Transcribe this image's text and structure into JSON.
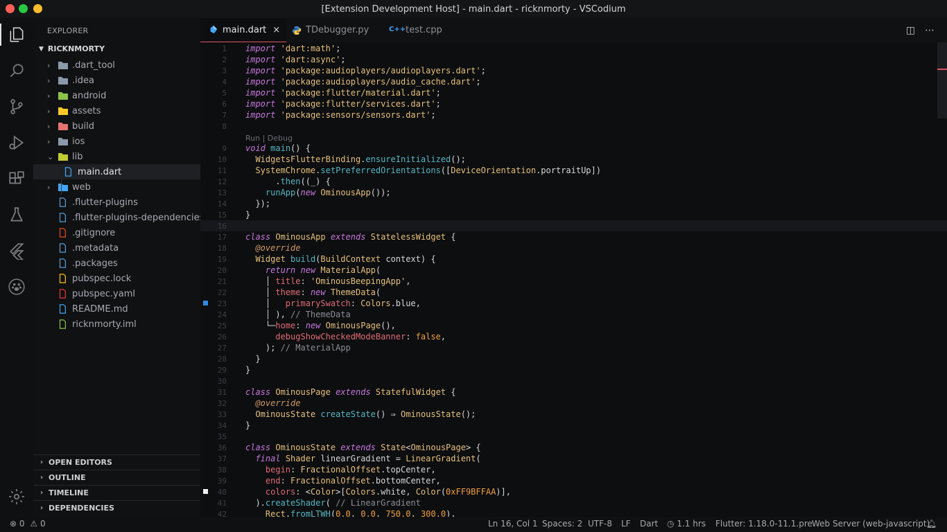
{
  "window": {
    "title": "[Extension Development Host] - main.dart - ricknmorty - VSCodium"
  },
  "explorer": {
    "header": "EXPLORER",
    "root": "RICKNMORTY",
    "items": [
      {
        "label": ".dart_tool",
        "kind": "folder",
        "icon": "folder-icon",
        "color": "#8a9aaa"
      },
      {
        "label": ".idea",
        "kind": "folder",
        "icon": "folder-icon",
        "color": "#8a9aaa"
      },
      {
        "label": "android",
        "kind": "folder",
        "icon": "android-folder-icon",
        "color": "#8bc34a"
      },
      {
        "label": "assets",
        "kind": "folder",
        "icon": "assets-folder-icon",
        "color": "#ffca28"
      },
      {
        "label": "build",
        "kind": "folder",
        "icon": "build-folder-icon",
        "color": "#e57373"
      },
      {
        "label": "ios",
        "kind": "folder",
        "icon": "ios-folder-icon",
        "color": "#8a9aaa"
      },
      {
        "label": "lib",
        "kind": "folder-open",
        "icon": "lib-folder-icon",
        "color": "#c0ca33"
      },
      {
        "label": "main.dart",
        "kind": "file",
        "icon": "dart-icon",
        "color": "#42a5f5"
      },
      {
        "label": "web",
        "kind": "folder",
        "icon": "web-folder-icon",
        "color": "#42a5f5"
      },
      {
        "label": ".flutter-plugins",
        "kind": "file",
        "icon": "file-icon",
        "color": "#5b9bd5"
      },
      {
        "label": ".flutter-plugins-dependencies",
        "kind": "file",
        "icon": "file-icon",
        "color": "#5b9bd5"
      },
      {
        "label": ".gitignore",
        "kind": "file",
        "icon": "git-icon",
        "color": "#e64a19"
      },
      {
        "label": ".metadata",
        "kind": "file",
        "icon": "file-icon",
        "color": "#5b9bd5"
      },
      {
        "label": ".packages",
        "kind": "file",
        "icon": "file-icon",
        "color": "#5b9bd5"
      },
      {
        "label": "pubspec.lock",
        "kind": "file",
        "icon": "lock-icon",
        "color": "#ffc107"
      },
      {
        "label": "pubspec.yaml",
        "kind": "file",
        "icon": "yaml-icon",
        "color": "#e53935"
      },
      {
        "label": "README.md",
        "kind": "file",
        "icon": "info-icon",
        "color": "#42a5f5"
      },
      {
        "label": "ricknmorty.iml",
        "kind": "file",
        "icon": "iml-icon",
        "color": "#8bc34a"
      }
    ],
    "sections": [
      "OPEN EDITORS",
      "OUTLINE",
      "TIMELINE",
      "DEPENDENCIES"
    ]
  },
  "tabs": [
    {
      "label": "main.dart",
      "icon": "dart-icon",
      "active": true,
      "close": "×"
    },
    {
      "label": "TDebugger.py",
      "icon": "python-icon",
      "active": false
    },
    {
      "label": "test.cpp",
      "icon": "cpp-icon",
      "active": false
    }
  ],
  "editor": {
    "codelens": "Run | Debug",
    "line_numbers": [
      "1",
      "2",
      "3",
      "4",
      "5",
      "6",
      "7",
      "8",
      "9",
      "10",
      "11",
      "12",
      "13",
      "14",
      "15",
      "16",
      "17",
      "18",
      "19",
      "20",
      "21",
      "22",
      "23",
      "24",
      "25",
      "26",
      "27",
      "28",
      "29",
      "30",
      "31",
      "32",
      "33",
      "34",
      "35",
      "36",
      "37",
      "38",
      "39",
      "40",
      "41",
      "42"
    ],
    "code": [
      "import 'dart:math';",
      "import 'dart:async';",
      "import 'package:audioplayers/audioplayers.dart';",
      "import 'package:audioplayers/audio_cache.dart';",
      "import 'package:flutter/material.dart';",
      "import 'package:flutter/services.dart';",
      "import 'package:sensors/sensors.dart';",
      "",
      "void main() {",
      "  WidgetsFlutterBinding.ensureInitialized();",
      "  SystemChrome.setPreferredOrientations([DeviceOrientation.portraitUp])",
      "      .then((_) {",
      "    runApp(new OminousApp());",
      "  });",
      "}",
      "",
      "class OminousApp extends StatelessWidget {",
      "  @override",
      "  Widget build(BuildContext context) {",
      "    return new MaterialApp(",
      "    │ title: 'OminousBeepingApp',",
      "    │ theme: new ThemeData(",
      "    │   primarySwatch: Colors.blue,",
      "    │ ), // ThemeData",
      "    └─home: new OminousPage(),",
      "      debugShowCheckedModeBanner: false,",
      "    ); // MaterialApp",
      "  }",
      "}",
      "",
      "class OminousPage extends StatefulWidget {",
      "  @override",
      "  OminousState createState() ⇒ OminousState();",
      "}",
      "",
      "class OminousState extends State<OminousPage> {",
      "  final Shader linearGradient = LinearGradient(",
      "    begin: FractionalOffset.topCenter,",
      "    end: FractionalOffset.bottomCenter,",
      "    colors: <Color>[Colors.white, Color(0xFF9BFFAA)],",
      "  ).createShader( // LinearGradient",
      "    Rect.fromLTWH(0.0, 0.0, 750.0, 300.0),"
    ]
  },
  "status": {
    "errors": "0",
    "warnings": "0",
    "position": "Ln 16, Col 1",
    "spaces": "Spaces: 2",
    "encoding": "UTF-8",
    "eol": "LF",
    "language": "Dart",
    "time": "1.1 hrs",
    "flutter": "Flutter: 1.18.0-11.1.pre",
    "server": "Web Server (web-javascript)"
  }
}
